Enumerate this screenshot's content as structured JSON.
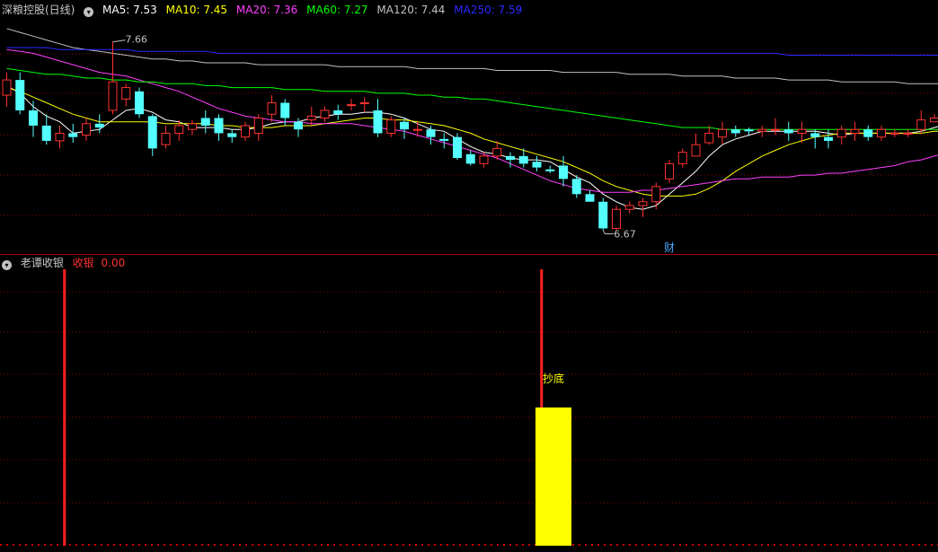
{
  "main_panel": {
    "title": "深粮控股(日线)",
    "indicators": [
      {
        "label": "MA5: 7.53",
        "color": "#ffffff"
      },
      {
        "label": "MA10: 7.45",
        "color": "#ffff00"
      },
      {
        "label": "MA20: 7.36",
        "color": "#ff40ff"
      },
      {
        "label": "MA60: 7.27",
        "color": "#00ff00"
      },
      {
        "label": "MA120: 7.44",
        "color": "#c0c0c0"
      },
      {
        "label": "MA250: 7.59",
        "color": "#2a2aff"
      }
    ],
    "high_label": "7.66",
    "low_label": "6.67",
    "event_label": "财"
  },
  "sub_panel": {
    "title": "老谭收银",
    "series_label": "收银",
    "series_value": "0.00",
    "signal_label": "抄底"
  },
  "colors": {
    "up": "#ff3232",
    "down": "#54ffff",
    "grid": "#8b0000",
    "signal_bar": "#ffff00",
    "signal_text": "#ffff00"
  },
  "chart_data": [
    {
      "type": "candlestick",
      "title": "深粮控股(日线)",
      "ylim": [
        6.55,
        7.8
      ],
      "candles": [
        [
          7.38,
          7.46,
          7.5,
          7.32
        ],
        [
          7.46,
          7.3,
          7.5,
          7.28
        ],
        [
          7.3,
          7.22,
          7.35,
          7.16
        ],
        [
          7.22,
          7.14,
          7.28,
          7.12
        ],
        [
          7.14,
          7.18,
          7.22,
          7.1
        ],
        [
          7.18,
          7.16,
          7.23,
          7.13
        ],
        [
          7.17,
          7.23,
          7.26,
          7.14
        ],
        [
          7.23,
          7.21,
          7.28,
          7.18
        ],
        [
          7.3,
          7.45,
          7.66,
          7.28
        ],
        [
          7.36,
          7.42,
          7.44,
          7.32
        ],
        [
          7.4,
          7.28,
          7.42,
          7.26
        ],
        [
          7.27,
          7.1,
          7.28,
          7.06
        ],
        [
          7.12,
          7.18,
          7.22,
          7.1
        ],
        [
          7.18,
          7.22,
          7.25,
          7.14
        ],
        [
          7.2,
          7.23,
          7.25,
          7.17
        ],
        [
          7.26,
          7.22,
          7.3,
          7.18
        ],
        [
          7.26,
          7.18,
          7.28,
          7.14
        ],
        [
          7.18,
          7.16,
          7.2,
          7.13
        ],
        [
          7.16,
          7.22,
          7.24,
          7.14
        ],
        [
          7.18,
          7.26,
          7.28,
          7.14
        ],
        [
          7.28,
          7.34,
          7.38,
          7.24
        ],
        [
          7.34,
          7.26,
          7.36,
          7.22
        ],
        [
          7.24,
          7.2,
          7.26,
          7.16
        ],
        [
          7.25,
          7.27,
          7.32,
          7.22
        ],
        [
          7.26,
          7.3,
          7.32,
          7.24
        ],
        [
          7.3,
          7.28,
          7.33,
          7.25
        ],
        [
          7.33,
          7.33,
          7.36,
          7.3
        ],
        [
          7.34,
          7.34,
          7.37,
          7.29
        ],
        [
          7.3,
          7.18,
          7.36,
          7.16
        ],
        [
          7.18,
          7.25,
          7.27,
          7.16
        ],
        [
          7.24,
          7.2,
          7.26,
          7.15
        ],
        [
          7.2,
          7.2,
          7.24,
          7.16
        ],
        [
          7.2,
          7.16,
          7.22,
          7.12
        ],
        [
          7.15,
          7.14,
          7.18,
          7.1
        ],
        [
          7.16,
          7.05,
          7.18,
          7.04
        ],
        [
          7.07,
          7.02,
          7.09,
          7.01
        ],
        [
          7.02,
          7.06,
          7.08,
          7.0
        ],
        [
          7.06,
          7.1,
          7.14,
          7.04
        ],
        [
          7.06,
          7.04,
          7.08,
          7.0
        ],
        [
          7.06,
          7.02,
          7.1,
          7.0
        ],
        [
          7.03,
          7.0,
          7.06,
          6.98
        ],
        [
          6.99,
          6.98,
          7.01,
          6.97
        ],
        [
          7.01,
          6.94,
          7.06,
          6.9
        ],
        [
          6.94,
          6.86,
          6.96,
          6.84
        ],
        [
          6.86,
          6.82,
          6.88,
          6.82
        ],
        [
          6.82,
          6.68,
          6.84,
          6.67
        ],
        [
          6.68,
          6.78,
          6.8,
          6.67
        ],
        [
          6.78,
          6.8,
          6.82,
          6.76
        ],
        [
          6.8,
          6.82,
          6.84,
          6.74
        ],
        [
          6.82,
          6.9,
          6.92,
          6.78
        ],
        [
          6.94,
          7.02,
          7.04,
          6.92
        ],
        [
          7.02,
          7.08,
          7.1,
          7.0
        ],
        [
          7.06,
          7.12,
          7.18,
          7.06
        ],
        [
          7.13,
          7.18,
          7.22,
          7.12
        ],
        [
          7.16,
          7.2,
          7.24,
          7.12
        ],
        [
          7.2,
          7.18,
          7.22,
          7.16
        ],
        [
          7.2,
          7.19,
          7.21,
          7.17
        ],
        [
          7.19,
          7.2,
          7.22,
          7.16
        ],
        [
          7.2,
          7.2,
          7.26,
          7.17
        ],
        [
          7.2,
          7.18,
          7.24,
          7.14
        ],
        [
          7.18,
          7.2,
          7.24,
          7.13
        ],
        [
          7.18,
          7.16,
          7.2,
          7.1
        ],
        [
          7.16,
          7.14,
          7.2,
          7.1
        ],
        [
          7.16,
          7.2,
          7.22,
          7.12
        ],
        [
          7.18,
          7.2,
          7.24,
          7.14
        ],
        [
          7.2,
          7.16,
          7.22,
          7.14
        ],
        [
          7.16,
          7.2,
          7.22,
          7.14
        ],
        [
          7.18,
          7.18,
          7.2,
          7.16
        ],
        [
          7.18,
          7.18,
          7.2,
          7.16
        ],
        [
          7.2,
          7.25,
          7.3,
          7.18
        ],
        [
          7.24,
          7.26,
          7.28,
          7.24
        ],
        [
          7.28,
          7.34,
          7.36,
          7.26
        ],
        [
          7.28,
          7.32,
          7.34,
          7.26
        ],
        [
          7.31,
          7.36,
          7.38,
          7.29
        ],
        [
          7.34,
          7.4,
          7.42,
          7.32
        ],
        [
          7.4,
          7.44,
          7.46,
          7.36
        ],
        [
          7.44,
          7.48,
          7.52,
          7.42
        ],
        [
          7.48,
          7.52,
          7.56,
          7.46
        ],
        [
          7.52,
          7.5,
          7.58,
          7.48
        ],
        [
          7.52,
          7.56,
          7.58,
          7.5
        ]
      ],
      "moving_averages": [
        {
          "name": "MA5",
          "color": "#ffffff",
          "values": [
            7.43,
            7.39,
            7.32,
            7.27,
            7.24,
            7.18,
            7.19,
            7.2,
            7.25,
            7.3,
            7.31,
            7.29,
            7.25,
            7.24,
            7.21,
            7.21,
            7.21,
            7.2,
            7.2,
            7.21,
            7.23,
            7.24,
            7.24,
            7.26,
            7.27,
            7.28,
            7.28,
            7.29,
            7.29,
            7.28,
            7.26,
            7.23,
            7.2,
            7.19,
            7.15,
            7.11,
            7.08,
            7.07,
            7.05,
            7.04,
            7.04,
            7.03,
            6.99,
            6.95,
            6.92,
            6.86,
            6.82,
            6.79,
            6.78,
            6.8,
            6.86,
            6.92,
            6.98,
            7.06,
            7.12,
            7.15,
            7.17,
            7.19,
            7.19,
            7.19,
            7.19,
            7.19,
            7.18,
            7.17,
            7.18,
            7.18,
            7.18,
            7.18,
            7.18,
            7.19,
            7.21,
            7.23,
            7.27,
            7.3,
            7.35,
            7.38,
            7.41,
            7.44,
            7.47,
            7.5
          ]
        },
        {
          "name": "MA10",
          "color": "#ffff00",
          "values": [
            7.42,
            7.4,
            7.37,
            7.34,
            7.31,
            7.28,
            7.26,
            7.24,
            7.24,
            7.24,
            7.24,
            7.24,
            7.23,
            7.23,
            7.23,
            7.23,
            7.22,
            7.22,
            7.21,
            7.21,
            7.21,
            7.22,
            7.22,
            7.22,
            7.23,
            7.24,
            7.25,
            7.26,
            7.26,
            7.25,
            7.25,
            7.24,
            7.23,
            7.22,
            7.2,
            7.18,
            7.15,
            7.13,
            7.11,
            7.09,
            7.07,
            7.05,
            7.03,
            7.0,
            6.97,
            6.93,
            6.9,
            6.88,
            6.86,
            6.85,
            6.85,
            6.85,
            6.86,
            6.89,
            6.93,
            6.98,
            7.02,
            7.06,
            7.09,
            7.12,
            7.14,
            7.16,
            7.17,
            7.18,
            7.18,
            7.18,
            7.18,
            7.18,
            7.18,
            7.18,
            7.19,
            7.19,
            7.2,
            7.21,
            7.23,
            7.25,
            7.28,
            7.31,
            7.34,
            7.37
          ]
        },
        {
          "name": "MA20",
          "color": "#ff40ff",
          "values": [
            7.62,
            7.61,
            7.6,
            7.58,
            7.56,
            7.54,
            7.52,
            7.5,
            7.49,
            7.48,
            7.46,
            7.44,
            7.42,
            7.4,
            7.37,
            7.34,
            7.31,
            7.29,
            7.27,
            7.26,
            7.25,
            7.24,
            7.24,
            7.23,
            7.23,
            7.23,
            7.23,
            7.22,
            7.21,
            7.2,
            7.19,
            7.17,
            7.15,
            7.13,
            7.11,
            7.09,
            7.07,
            7.05,
            7.02,
            6.99,
            6.96,
            6.93,
            6.91,
            6.89,
            6.88,
            6.87,
            6.87,
            6.87,
            6.88,
            6.88,
            6.89,
            6.9,
            6.91,
            6.92,
            6.93,
            6.94,
            6.94,
            6.95,
            6.95,
            6.95,
            6.96,
            6.96,
            6.97,
            6.97,
            6.98,
            6.99,
            7.0,
            7.01,
            7.03,
            7.04,
            7.06,
            7.08,
            7.1,
            7.12,
            7.14,
            7.16,
            7.18,
            7.2,
            7.22,
            7.24
          ]
        },
        {
          "name": "MA60",
          "color": "#00ff00",
          "values": [
            7.52,
            7.51,
            7.5,
            7.49,
            7.49,
            7.48,
            7.47,
            7.47,
            7.46,
            7.46,
            7.45,
            7.45,
            7.44,
            7.44,
            7.44,
            7.43,
            7.43,
            7.42,
            7.42,
            7.42,
            7.42,
            7.41,
            7.41,
            7.41,
            7.4,
            7.4,
            7.4,
            7.4,
            7.39,
            7.39,
            7.39,
            7.38,
            7.38,
            7.37,
            7.37,
            7.36,
            7.36,
            7.35,
            7.34,
            7.33,
            7.32,
            7.31,
            7.3,
            7.29,
            7.28,
            7.27,
            7.26,
            7.25,
            7.24,
            7.23,
            7.22,
            7.21,
            7.21,
            7.21,
            7.2,
            7.2,
            7.2,
            7.2,
            7.2,
            7.2,
            7.2,
            7.2,
            7.2,
            7.2,
            7.2,
            7.2,
            7.2,
            7.2,
            7.2,
            7.2,
            7.2,
            7.2,
            7.2,
            7.2,
            7.21,
            7.21,
            7.21,
            7.21,
            7.21,
            7.21
          ]
        },
        {
          "name": "MA120",
          "color": "#c0c0c0",
          "values": [
            7.73,
            7.71,
            7.69,
            7.67,
            7.65,
            7.63,
            7.62,
            7.61,
            7.6,
            7.59,
            7.58,
            7.57,
            7.57,
            7.56,
            7.56,
            7.55,
            7.55,
            7.55,
            7.55,
            7.54,
            7.54,
            7.54,
            7.54,
            7.54,
            7.54,
            7.53,
            7.53,
            7.53,
            7.53,
            7.53,
            7.53,
            7.52,
            7.52,
            7.52,
            7.52,
            7.52,
            7.52,
            7.51,
            7.51,
            7.51,
            7.51,
            7.51,
            7.5,
            7.5,
            7.5,
            7.5,
            7.5,
            7.49,
            7.49,
            7.49,
            7.49,
            7.48,
            7.48,
            7.48,
            7.48,
            7.47,
            7.47,
            7.47,
            7.47,
            7.46,
            7.46,
            7.46,
            7.46,
            7.45,
            7.45,
            7.45,
            7.45,
            7.45,
            7.44,
            7.44,
            7.44,
            7.44,
            7.44,
            7.44,
            7.44,
            7.44,
            7.44,
            7.44,
            7.44,
            7.44
          ]
        },
        {
          "name": "MA250",
          "color": "#2a2aff",
          "values": [
            7.63,
            7.63,
            7.63,
            7.63,
            7.62,
            7.62,
            7.62,
            7.62,
            7.62,
            7.62,
            7.61,
            7.61,
            7.61,
            7.61,
            7.61,
            7.61,
            7.6,
            7.6,
            7.6,
            7.6,
            7.6,
            7.6,
            7.6,
            7.6,
            7.6,
            7.6,
            7.6,
            7.6,
            7.6,
            7.6,
            7.6,
            7.6,
            7.6,
            7.6,
            7.6,
            7.6,
            7.6,
            7.6,
            7.6,
            7.6,
            7.6,
            7.6,
            7.6,
            7.6,
            7.6,
            7.6,
            7.6,
            7.6,
            7.6,
            7.6,
            7.6,
            7.6,
            7.6,
            7.6,
            7.6,
            7.6,
            7.6,
            7.6,
            7.6,
            7.59,
            7.59,
            7.59,
            7.59,
            7.59,
            7.59,
            7.59,
            7.59,
            7.59,
            7.59,
            7.59,
            7.59,
            7.59,
            7.59,
            7.59,
            7.59,
            7.59,
            7.59,
            7.59,
            7.59,
            7.59
          ]
        }
      ],
      "annotations": [
        {
          "text": "7.66",
          "index": 8,
          "value": 7.66
        },
        {
          "text": "6.67",
          "index": 45,
          "value": 6.67
        },
        {
          "text": "财",
          "index": 50
        }
      ]
    },
    {
      "type": "bar",
      "title": "老谭收银",
      "ylim": [
        0,
        1
      ],
      "signal_lines": [
        {
          "index": 3,
          "value": 1.0,
          "color": "#ff2020"
        },
        {
          "index": 39,
          "value": 1.0,
          "color": "#ff2020"
        }
      ],
      "bars": [
        {
          "start_index": 40,
          "end_index": 42,
          "value": 0.5,
          "color": "#ffff00",
          "label": "抄底"
        }
      ]
    }
  ]
}
